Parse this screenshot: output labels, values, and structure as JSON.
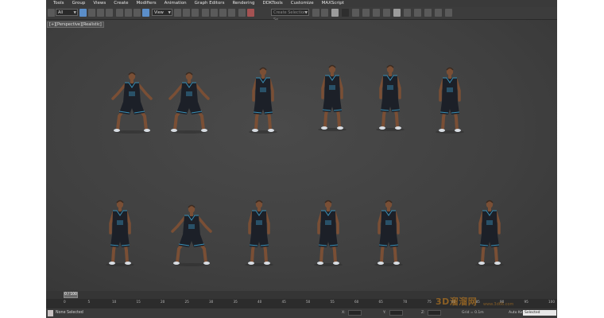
{
  "menubar": {
    "items": [
      "Tools",
      "Group",
      "Views",
      "Create",
      "Modifiers",
      "Animation",
      "Graph Editors",
      "Rendering",
      "DDKTools",
      "Customize",
      "MAXScript"
    ]
  },
  "toolbar": {
    "selection_filter": "All",
    "reference_coord": "View",
    "named_selection_placeholder": "Create Selection Se"
  },
  "viewport": {
    "label": "[+][Perspective][Realistic]"
  },
  "timeline": {
    "slider": "0 / 100"
  },
  "trackbar": {
    "ticks": [
      "0",
      "5",
      "10",
      "15",
      "20",
      "25",
      "30",
      "35",
      "40",
      "45",
      "50",
      "55",
      "60",
      "65",
      "70",
      "75",
      "80",
      "85",
      "90",
      "95",
      "100"
    ]
  },
  "statusbar": {
    "message": "None Selected",
    "x_label": "X:",
    "y_label": "Y:",
    "z_label": "Z:",
    "grid": "Grid = 0.1m",
    "auto_key": "Auto Key",
    "key_mode": "Selected"
  },
  "watermark": {
    "text": "3D溜溜网",
    "url": "www.3d66.com"
  },
  "colors": {
    "jersey": "#1c2028",
    "jersey_trim": "#3a8fb5",
    "skin": "#7a4f35",
    "shoe": "#d8dde3",
    "viewport_bg": "#444444",
    "timeline_accent": "#caa43a"
  },
  "figures": {
    "row1": [
      {
        "pose": "defensive-crouch-wide"
      },
      {
        "pose": "defensive-crouch-wide"
      },
      {
        "pose": "crouch-hands-low"
      },
      {
        "pose": "standing-hand-up"
      },
      {
        "pose": "standing-relaxed"
      },
      {
        "pose": "crouch-reaching"
      }
    ],
    "row2": [
      {
        "pose": "standing-holding-ball"
      },
      {
        "pose": "deep-crouch"
      },
      {
        "pose": "standing-looking-up"
      },
      {
        "pose": "standing-arms-out"
      },
      {
        "pose": "standing-arms-down"
      },
      {
        "pose": "standing-side"
      }
    ]
  }
}
